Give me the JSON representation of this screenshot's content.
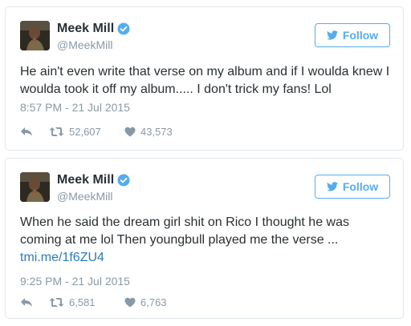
{
  "tweets": [
    {
      "author": {
        "name": "Meek Mill",
        "handle": "@MeekMill",
        "verified": true
      },
      "follow_label": "Follow",
      "text": "He ain't even write that verse on my album and if I woulda knew I woulda took it off my album..... I don't trick my fans! Lol",
      "link": "",
      "timestamp": "8:57 PM - 21 Jul 2015",
      "retweets": "52,607",
      "likes": "43,573"
    },
    {
      "author": {
        "name": "Meek Mill",
        "handle": "@MeekMill",
        "verified": true
      },
      "follow_label": "Follow",
      "text": "When he said the dream girl shit on Rico I thought he was coming at me lol Then youngbull played me the verse ...",
      "link": "tmi.me/1f6ZU4",
      "timestamp": "9:25 PM - 21 Jul 2015",
      "retweets": "6,581",
      "likes": "6,763"
    }
  ],
  "colors": {
    "accent": "#55acee",
    "link": "#2b7bb9",
    "muted": "#8899a6",
    "text": "#292f33",
    "border": "#e1e8ed"
  },
  "icons": [
    "verified-badge-icon",
    "twitter-bird-icon",
    "reply-icon",
    "retweet-icon",
    "heart-icon"
  ]
}
